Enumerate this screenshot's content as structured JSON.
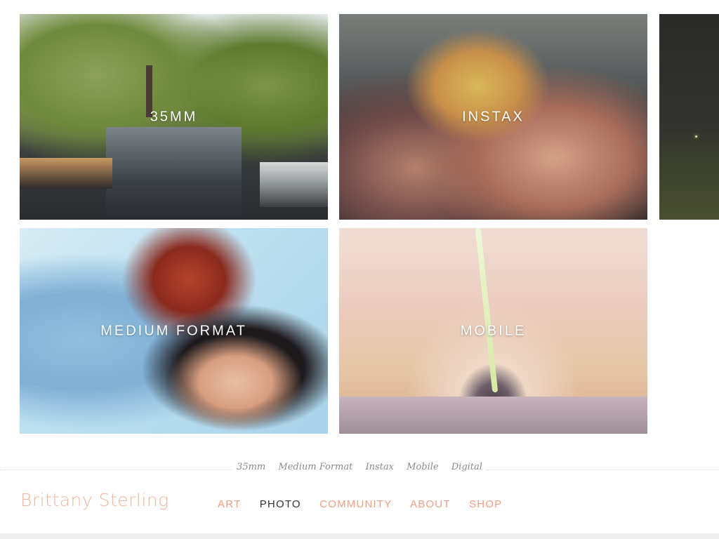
{
  "gallery": {
    "tiles": [
      {
        "label": "35MM",
        "image": "canal-with-houseboats"
      },
      {
        "label": "INSTAX",
        "image": "party-crowd-confetti"
      },
      {
        "label": "",
        "image": "dark-field-night"
      },
      {
        "label": "MEDIUM FORMAT",
        "image": "woman-floral-headdress"
      },
      {
        "label": "MOBILE",
        "image": "pink-tunnel"
      }
    ]
  },
  "subnav": {
    "items": [
      "35mm",
      "Medium Format",
      "Instax",
      "Mobile",
      "Digital"
    ]
  },
  "footer": {
    "brand": "Brittany Sterling",
    "nav": [
      {
        "label": "ART",
        "active": false
      },
      {
        "label": "PHOTO",
        "active": true
      },
      {
        "label": "COMMUNITY",
        "active": false
      },
      {
        "label": "ABOUT",
        "active": false
      },
      {
        "label": "SHOP",
        "active": false
      }
    ]
  },
  "colors": {
    "brand": "#f0b69f",
    "nav_link": "#ef9f84",
    "nav_active": "#333333",
    "subnav_text": "#8a8a8a"
  }
}
